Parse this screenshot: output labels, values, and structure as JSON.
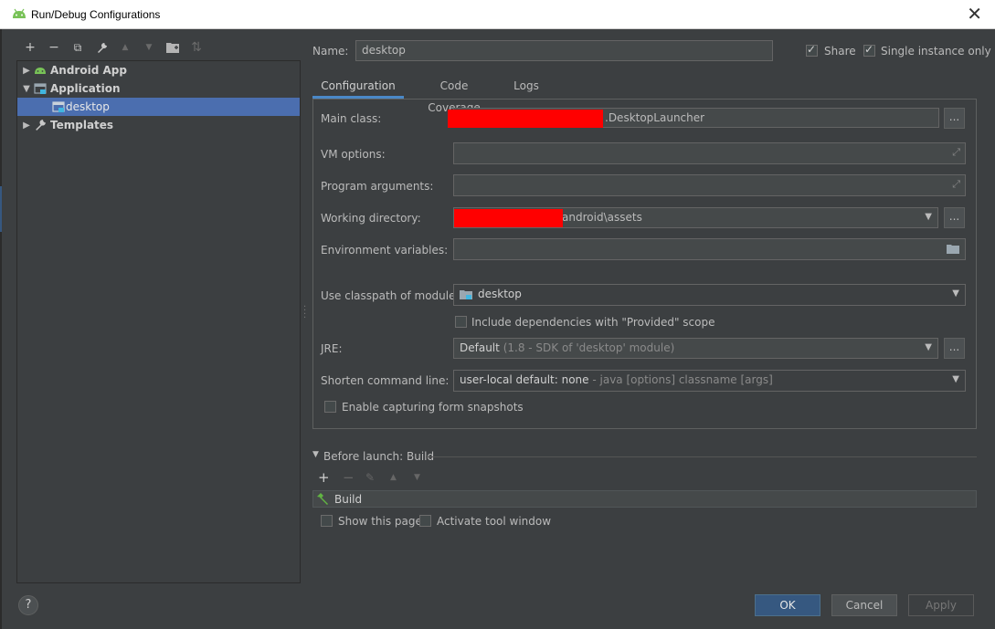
{
  "window": {
    "title": "Run/Debug Configurations",
    "close_glyph": "✕"
  },
  "toolbar": {
    "items": [
      {
        "name": "add-icon",
        "glyph": "+"
      },
      {
        "name": "remove-icon",
        "glyph": "−"
      },
      {
        "name": "copy-icon",
        "glyph": "⧉"
      },
      {
        "name": "wrench-icon",
        "glyph": "🔧"
      },
      {
        "name": "move-up-icon",
        "glyph": "▲"
      },
      {
        "name": "move-down-icon",
        "glyph": "▼"
      },
      {
        "name": "folder-icon",
        "glyph": "▣"
      },
      {
        "name": "sort-icon",
        "glyph": "⇅"
      }
    ]
  },
  "tree": {
    "items": [
      {
        "label": "Android App",
        "icon": "android-icon",
        "expanded": false
      },
      {
        "label": "Application",
        "icon": "application-icon",
        "expanded": true
      },
      {
        "label": "desktop",
        "icon": "application-config-icon",
        "selected": true
      },
      {
        "label": "Templates",
        "icon": "wrench-icon",
        "expanded": false
      }
    ]
  },
  "header": {
    "name_label": "Name:",
    "name_value": "desktop",
    "share_label": "Share",
    "single_instance_label": "Single instance only"
  },
  "tabs": [
    "Configuration",
    "Code Coverage",
    "Logs"
  ],
  "form": {
    "main_class_label": "Main class:",
    "main_class_value": ".DesktopLauncher",
    "vm_options_label": "VM options:",
    "program_args_label": "Program arguments:",
    "working_dir_label": "Working directory:",
    "working_dir_value": "\\android\\assets",
    "env_vars_label": "Environment variables:",
    "classpath_label": "Use classpath of module:",
    "classpath_value": "desktop",
    "include_deps_label": "Include dependencies with \"Provided\" scope",
    "jre_label": "JRE:",
    "jre_value": "Default",
    "jre_detail": "(1.8 - SDK of 'desktop' module)",
    "shorten_label": "Shorten command line:",
    "shorten_value": "user-local default: none",
    "shorten_detail": "- java [options] classname [args]",
    "snapshots_label": "Enable capturing form snapshots",
    "dots": "..."
  },
  "before_launch": {
    "title": "Before launch: Build",
    "task": "Build",
    "show_page_label": "Show this page",
    "activate_tool_label": "Activate tool window"
  },
  "footer": {
    "ok": "OK",
    "cancel": "Cancel",
    "apply": "Apply",
    "help": "?"
  },
  "colors": {
    "accent": "#4b6eaf",
    "primary_button": "#365880",
    "redaction": "#ff0000"
  }
}
